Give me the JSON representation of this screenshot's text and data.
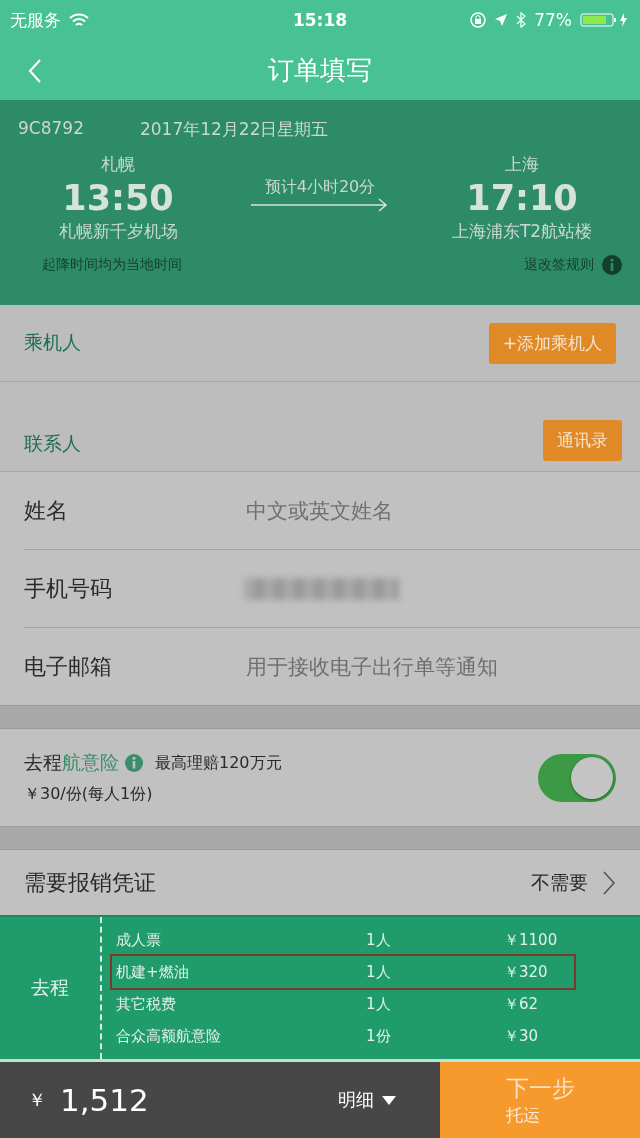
{
  "status_bar": {
    "carrier": "无服务",
    "time": "15:18",
    "battery": "77%"
  },
  "nav": {
    "title": "订单填写"
  },
  "flight": {
    "number": "9C8792",
    "date": "2017年12月22日星期五",
    "from": {
      "city": "札幌",
      "time": "13:50",
      "airport": "札幌新千岁机场"
    },
    "duration": "预计4小时20分",
    "to": {
      "city": "上海",
      "time": "17:10",
      "airport": "上海浦东T2航站楼"
    },
    "note": "起降时间均为当地时间",
    "rules_link": "退改签规则"
  },
  "passengers": {
    "label": "乘机人",
    "button": "+添加乘机人"
  },
  "contact": {
    "label": "联系人",
    "button": "通讯录"
  },
  "fields": [
    {
      "kind": "input",
      "label": "姓名",
      "placeholder": "中文或英文姓名"
    },
    {
      "kind": "blurred",
      "label": "手机号码"
    },
    {
      "kind": "input",
      "label": "电子邮箱",
      "placeholder": "用于接收电子出行单等通知"
    }
  ],
  "insurance": {
    "prefix": "去程",
    "name": "航意险",
    "claim": "最高理赔120万元",
    "price": "￥30/份(每人1份)",
    "on": true
  },
  "receipt": {
    "label": "需要报销凭证",
    "value": "不需要"
  },
  "price_detail": {
    "leg": "去程",
    "rows": [
      {
        "item": "成人票",
        "qty": "1人",
        "amount": "￥1100",
        "marked": false
      },
      {
        "item": "机建+燃油",
        "qty": "1人",
        "amount": "￥320",
        "marked": true
      },
      {
        "item": "其它税费",
        "qty": "1人",
        "amount": "￥62",
        "marked": false
      },
      {
        "item": "合众高额航意险",
        "qty": "1份",
        "amount": "￥30",
        "marked": false
      }
    ]
  },
  "bottom_bar": {
    "currency": "￥",
    "total": "1,512",
    "details": "明细",
    "next": "下一步",
    "next_sub": "托运"
  }
}
